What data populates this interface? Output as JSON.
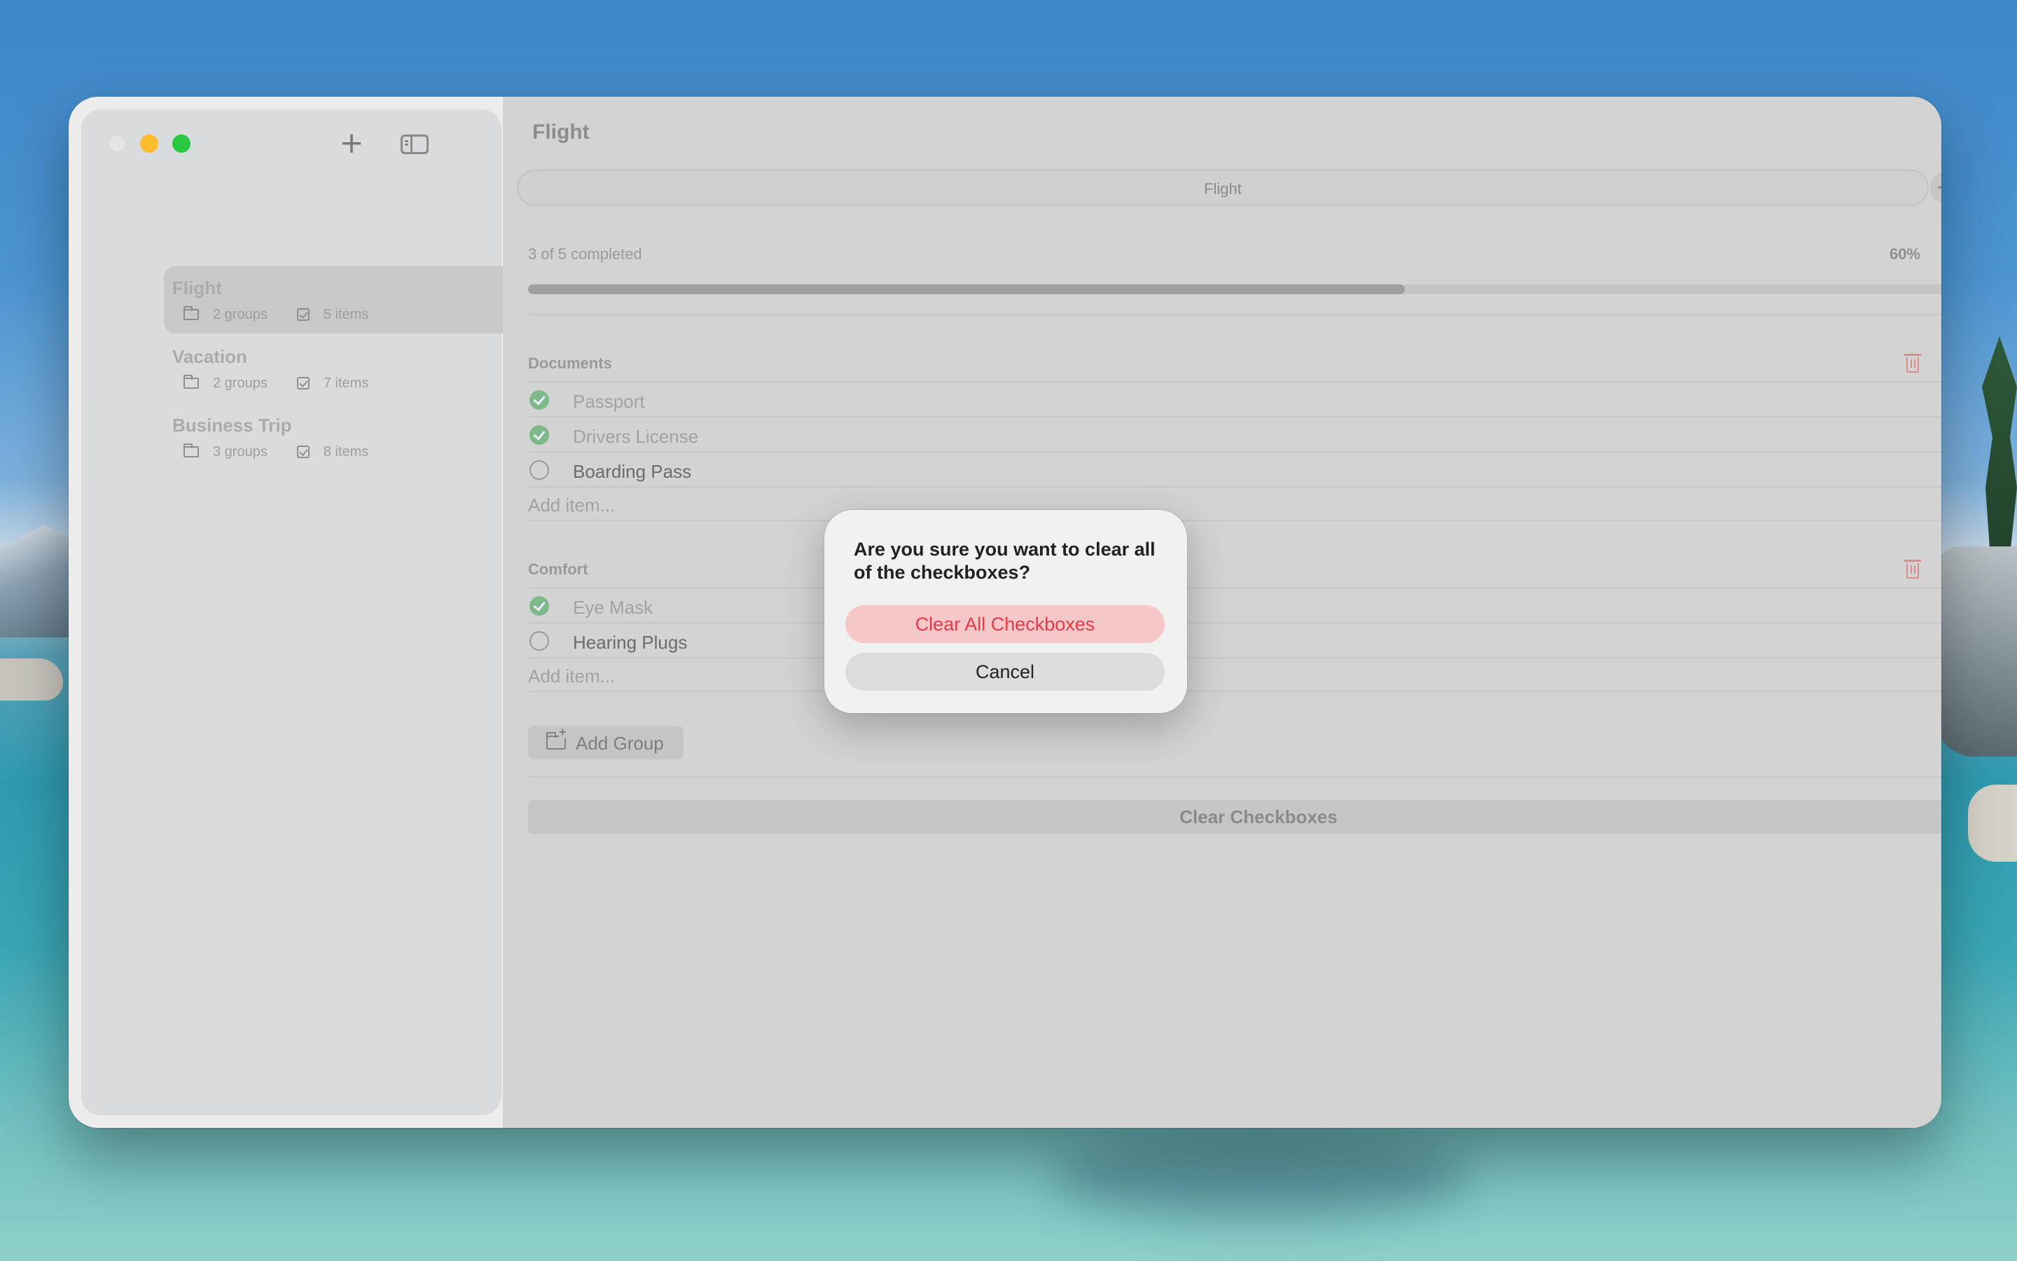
{
  "sidebar": {
    "lists": [
      {
        "title": "Flight",
        "groups": "2 groups",
        "items": "5 items",
        "selected": true
      },
      {
        "title": "Vacation",
        "groups": "2 groups",
        "items": "7 items",
        "selected": false
      },
      {
        "title": "Business Trip",
        "groups": "3 groups",
        "items": "8 items",
        "selected": false
      }
    ],
    "add_icon": "plus-icon",
    "toggle_icon": "sidebar-toggle-icon"
  },
  "main": {
    "title": "Flight",
    "tab_label": "Flight",
    "progress": {
      "label": "3 of 5 completed",
      "percent_text": "60%",
      "fraction": 0.6
    },
    "groups": [
      {
        "name": "Documents",
        "items": [
          {
            "label": "Passport",
            "checked": true
          },
          {
            "label": "Drivers License",
            "checked": true
          },
          {
            "label": "Boarding Pass",
            "checked": false
          }
        ],
        "add_placeholder": "Add item..."
      },
      {
        "name": "Comfort",
        "items": [
          {
            "label": "Eye Mask",
            "checked": true
          },
          {
            "label": "Hearing Plugs",
            "checked": false
          }
        ],
        "add_placeholder": "Add item..."
      }
    ],
    "add_group_label": "Add Group",
    "clear_label": "Clear Checkboxes"
  },
  "dialog": {
    "message": "Are you sure you want to clear all of the checkboxes?",
    "primary_label": "Clear All Checkboxes",
    "cancel_label": "Cancel"
  },
  "colors": {
    "destructive": "#e53a45",
    "checked": "#7fb98a",
    "window_bg": "#d3d3d3"
  }
}
